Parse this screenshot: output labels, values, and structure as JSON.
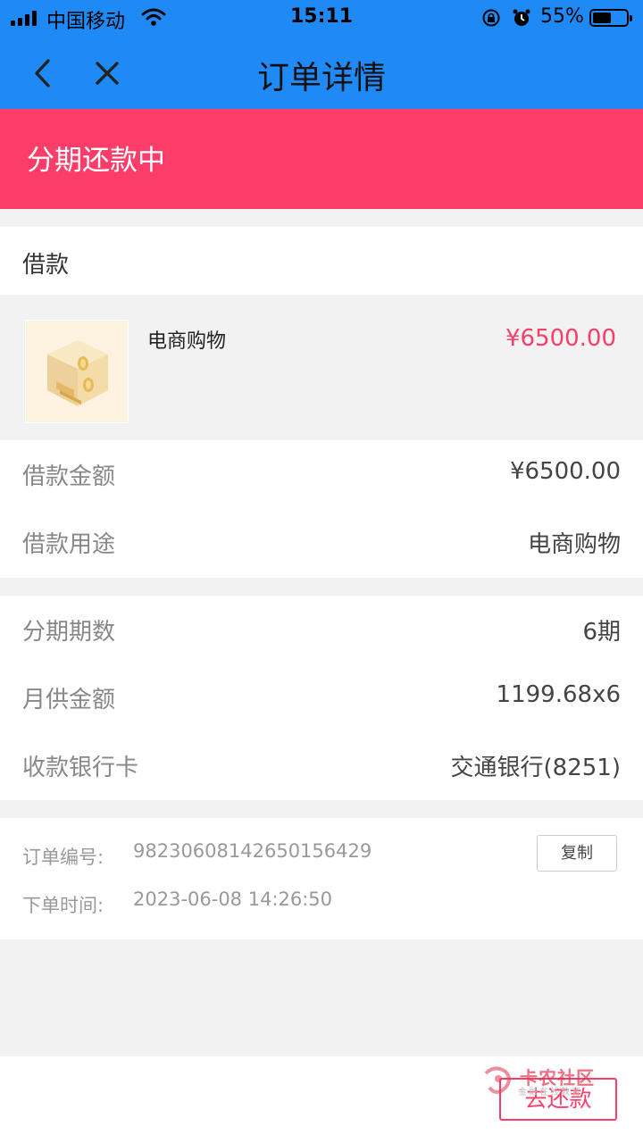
{
  "status_bar": {
    "carrier": "中国移动",
    "time": "15:11",
    "battery_percent": "55%",
    "battery_level": 0.55
  },
  "nav": {
    "title": "订单详情",
    "back_icon": "chevron-left-icon",
    "close_icon": "close-icon"
  },
  "banner": {
    "status_text": "分期还款中",
    "color": "#fc3d6a"
  },
  "loan": {
    "section_title": "借款",
    "product_name": "电商购物",
    "product_price": "¥6500.00"
  },
  "details_a": [
    {
      "label": "借款金额",
      "value": "¥6500.00"
    },
    {
      "label": "借款用途",
      "value": "电商购物"
    }
  ],
  "details_b": [
    {
      "label": "分期期数",
      "value": "6期"
    },
    {
      "label": "月供金额",
      "value": "1199.68x6"
    },
    {
      "label": "收款银行卡",
      "value": "交通银行(8251)"
    }
  ],
  "order": {
    "number_label": "订单编号:",
    "number_value": "98230608142650156429",
    "time_label": "下单时间:",
    "time_value": "2023-06-08 14:26:50",
    "copy_label": "复制"
  },
  "actions": {
    "repay_label": "去还款"
  },
  "watermark": {
    "text": "卡农社区",
    "sub": "金融在线教育"
  },
  "colors": {
    "nav_blue": "#1f8af5",
    "accent_pink": "#fc3d6a"
  }
}
